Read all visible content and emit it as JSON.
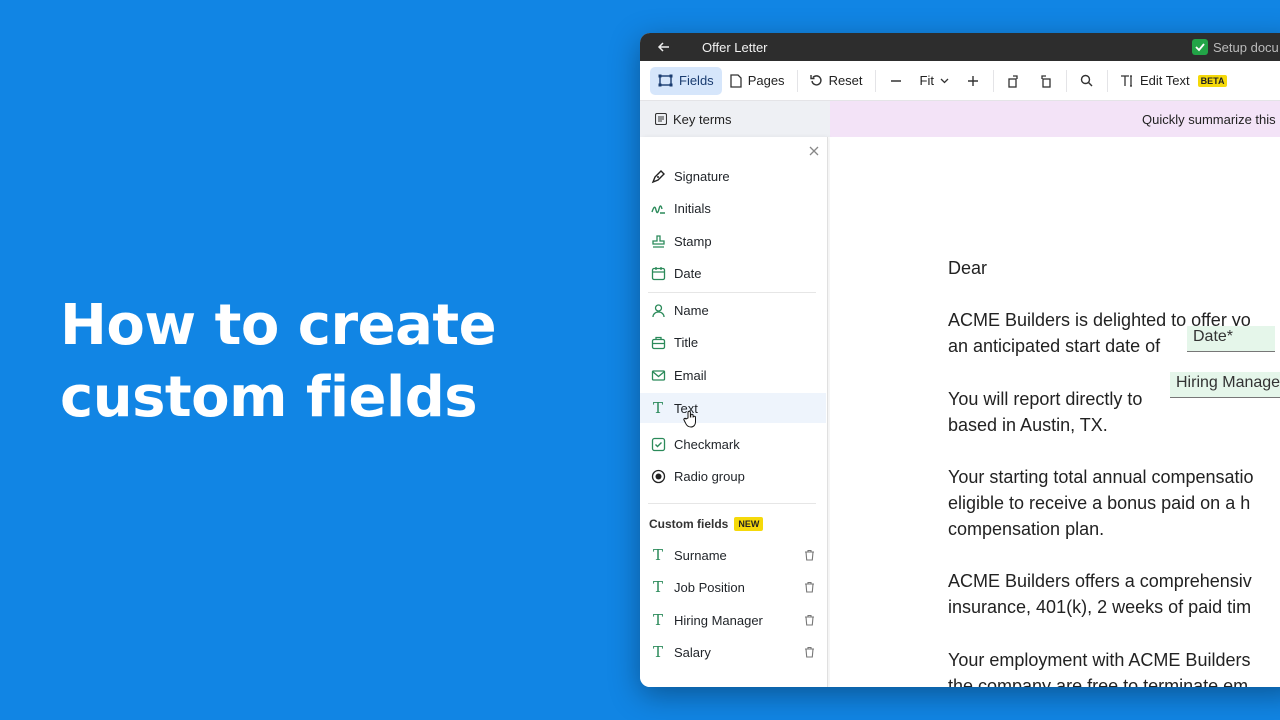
{
  "headline": {
    "line1": "How to create",
    "line2": "custom fields"
  },
  "window": {
    "title": "Offer Letter",
    "setup_label": "Setup docu"
  },
  "toolbar": {
    "fields_label": "Fields",
    "pages_label": "Pages",
    "reset_label": "Reset",
    "zoom_label": "Fit",
    "edit_text_label": "Edit Text",
    "beta_badge": "BETA"
  },
  "keybar": {
    "key_terms_label": "Key terms",
    "summarize_text": "Quickly summarize this"
  },
  "fields_panel": {
    "standard": [
      {
        "label": "Signature",
        "icon": "pen-icon"
      },
      {
        "label": "Initials",
        "icon": "initials-icon"
      },
      {
        "label": "Stamp",
        "icon": "stamp-icon"
      },
      {
        "label": "Date",
        "icon": "calendar-icon"
      },
      {
        "label": "Name",
        "icon": "person-icon"
      },
      {
        "label": "Title",
        "icon": "briefcase-icon"
      },
      {
        "label": "Email",
        "icon": "envelope-icon"
      },
      {
        "label": "Text",
        "icon": "text-icon"
      },
      {
        "label": "Checkmark",
        "icon": "checkbox-icon"
      },
      {
        "label": "Radio group",
        "icon": "radio-icon"
      }
    ],
    "custom_heading": "Custom fields",
    "new_badge": "NEW",
    "custom": [
      {
        "label": "Surname"
      },
      {
        "label": "Job Position"
      },
      {
        "label": "Hiring Manager"
      },
      {
        "label": "Salary"
      }
    ]
  },
  "document": {
    "greeting": "Dear",
    "line1": "ACME Builders is delighted to offer yo",
    "line2": "an anticipated start date of",
    "date_field": "Date*",
    "line3": "You will report directly to",
    "manager_field": "Hiring Manage",
    "line4": "based in Austin, TX.",
    "line5": "Your starting total annual compensatio",
    "line6": "eligible to receive a bonus paid on a h",
    "line7": "compensation plan.",
    "line8": "ACME Builders offers a comprehensiv",
    "line9": "insurance, 401(k), 2 weeks of paid tim",
    "line10": "Your employment with ACME Builders",
    "line11": "the company are free to terminate em"
  },
  "colors": {
    "background": "#1185e4",
    "field_green": "#2b8a5a",
    "badge_yellow": "#f5d90a",
    "active_tab": "#d6e6fb"
  }
}
